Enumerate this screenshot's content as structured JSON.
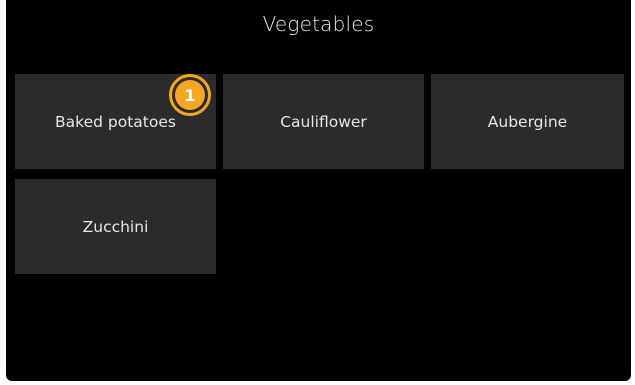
{
  "header": {
    "title": "Vegetables"
  },
  "tiles": [
    {
      "label": "Baked potatoes"
    },
    {
      "label": "Cauliflower"
    },
    {
      "label": "Aubergine"
    },
    {
      "label": "Zucchini"
    }
  ],
  "badge": {
    "number": "1",
    "color": "#f5a623"
  },
  "colors": {
    "background": "#000000",
    "tile": "#2b2b2b",
    "text": "#e6e6e6"
  }
}
